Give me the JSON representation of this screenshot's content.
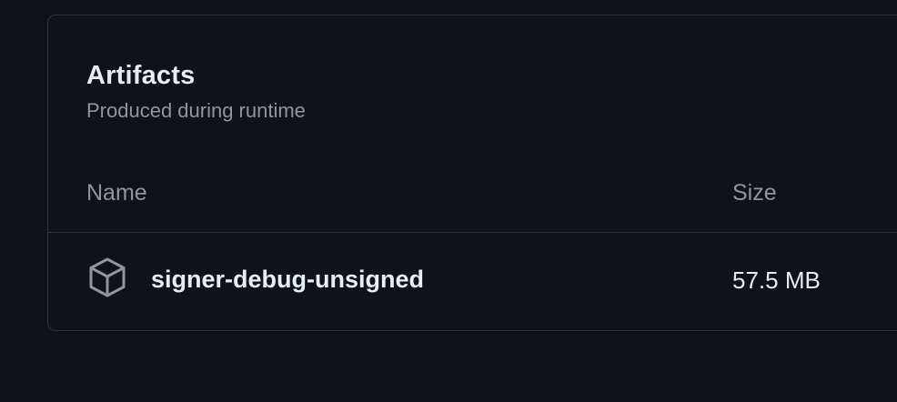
{
  "artifacts": {
    "title": "Artifacts",
    "subtitle": "Produced during runtime",
    "columns": {
      "name": "Name",
      "size": "Size"
    },
    "rows": [
      {
        "icon": "package-icon",
        "name": "signer-debug-unsigned",
        "size": "57.5 MB"
      }
    ]
  },
  "colors": {
    "background": "#0f1218",
    "border": "#30363d",
    "text_primary": "#e6edf3",
    "text_muted": "#8d96a0"
  }
}
